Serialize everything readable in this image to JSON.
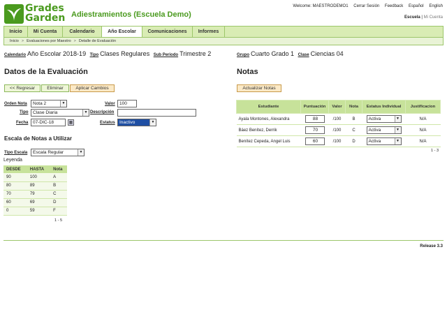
{
  "logo": {
    "line1": "Grades",
    "line2": "Garden"
  },
  "app_title": "Adiestramientos (Escuela Demo)",
  "top_links": {
    "welcome": "Welcome: MAESTRODEMO1",
    "logout": "Cerrar Sesión",
    "feedback": "Feedback",
    "spanish": "Español",
    "english": "English"
  },
  "roles": {
    "school": "Escuela",
    "separator": "|",
    "my_account": "Mi Cuenta"
  },
  "nav": {
    "tabs": [
      {
        "label": "Inicio"
      },
      {
        "label": "Mi Cuenta"
      },
      {
        "label": "Calendario"
      },
      {
        "label": "Año Escolar"
      },
      {
        "label": "Comunicaciones"
      },
      {
        "label": "Informes"
      }
    ]
  },
  "breadcrumb": [
    "Inicio",
    "Evaluaciones por Maestro",
    "Detalle de Evaluación"
  ],
  "context": {
    "calendar_label": "Calendario",
    "calendar_value": "Año Escolar 2018-19",
    "type_label": "Tipo",
    "type_value": "Clases Regulares",
    "subperiod_label": "Sub Periodo",
    "subperiod_value": "Trimestre 2",
    "group_label": "Grupo",
    "group_value": "Cuarto Grado 1",
    "class_label": "Clase",
    "class_value": "Ciencias 04"
  },
  "evaluation": {
    "title": "Datos de la Evaluación",
    "back_btn": "<< Regresar",
    "delete_btn": "Eliminar",
    "apply_btn": "Aplicar Cambios",
    "order_label": "Orden Nota",
    "order_value": "Nota 2",
    "value_label": "Valor",
    "value_value": "100",
    "type_label": "Tipo",
    "type_value": "Clase Diaria",
    "desc_label": "Descripción",
    "desc_value": "",
    "date_label": "Fecha",
    "date_value": "07-DIC-18",
    "status_label": "Estatus",
    "status_value": "Inactivo"
  },
  "scale": {
    "title": "Escala de Notas a Utilizar",
    "type_label": "Tipo Escala",
    "type_value": "Escala Regular",
    "legend": "Leyenda",
    "headers": [
      "DESDE",
      "HASTA",
      "Nota"
    ],
    "rows": [
      [
        "90",
        "100",
        "A"
      ],
      [
        "80",
        "89",
        "B"
      ],
      [
        "70",
        "79",
        "C"
      ],
      [
        "60",
        "69",
        "D"
      ],
      [
        "0",
        "59",
        "F"
      ]
    ],
    "count": "1 - 5"
  },
  "grades": {
    "title": "Notas",
    "update_btn": "Actualizar Notas",
    "headers": [
      "Estudiante",
      "Puntuación",
      "Valor",
      "Nota",
      "Estatus Individual",
      "Justificacion"
    ],
    "rows": [
      {
        "student": "Ayala Montones, Alexandra",
        "score": "88",
        "value": "/100",
        "grade": "B",
        "status": "Activa",
        "justification": "N/A"
      },
      {
        "student": "Báez Benítez, Derrik",
        "score": "70",
        "value": "/100",
        "grade": "C",
        "status": "Activa",
        "justification": "N/A"
      },
      {
        "student": "Benítez Cepeda, Angel Luis",
        "score": "60",
        "value": "/100",
        "grade": "D",
        "status": "Activa",
        "justification": "N/A"
      }
    ],
    "count": "1 - 3"
  },
  "release": "Release 3.3",
  "colors": {
    "brand_green": "#4a9a1e",
    "nav_bg": "#d9ecb4",
    "header_cell": "#c7e29a",
    "status_highlight": "#1f4fa3"
  }
}
